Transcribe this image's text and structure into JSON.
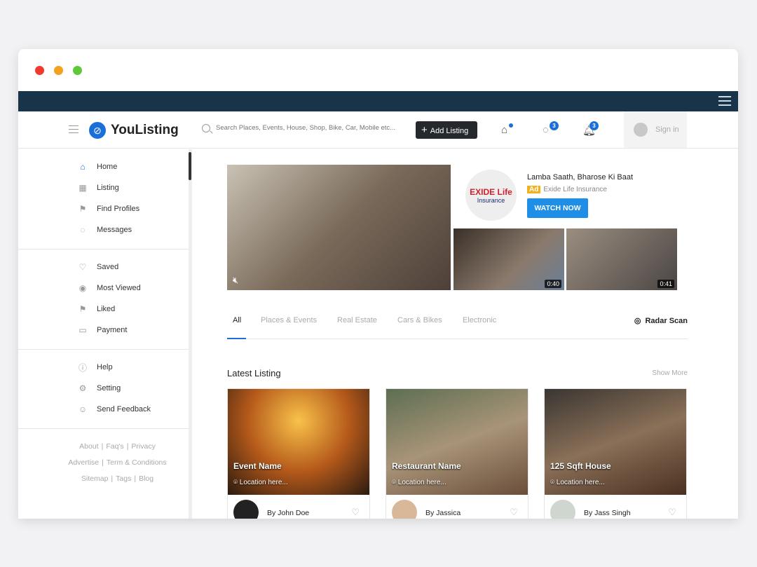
{
  "window": {
    "dots": [
      "#ee3b2e",
      "#f4a21e",
      "#5ec83a"
    ]
  },
  "header": {
    "logo": "YouListing",
    "search_placeholder": "Search Places, Events, House, Shop, Bike, Car, Mobile etc...",
    "add_listing": "Add Listing",
    "messages_count": "3",
    "notifications_count": "3",
    "sign_in": "Sign in"
  },
  "sidebar": {
    "groups": [
      [
        {
          "label": "Home",
          "icon": "⌂"
        },
        {
          "label": "Listing",
          "icon": "▦"
        },
        {
          "label": "Find Profiles",
          "icon": "⚑"
        },
        {
          "label": "Messages",
          "icon": "◌"
        }
      ],
      [
        {
          "label": "Saved",
          "icon": "♡"
        },
        {
          "label": "Most Viewed",
          "icon": "◉"
        },
        {
          "label": "Liked",
          "icon": "⚑"
        },
        {
          "label": "Payment",
          "icon": "▭"
        }
      ],
      [
        {
          "label": "Help",
          "icon": "ⓘ"
        },
        {
          "label": "Setting",
          "icon": "⚙"
        },
        {
          "label": "Send Feedback",
          "icon": "☺"
        }
      ]
    ],
    "footer": [
      "About",
      "Faq's",
      "Privacy",
      "Advertise",
      "Term & Conditions",
      "Sitemap",
      "Tags",
      "Blog"
    ]
  },
  "ad": {
    "title": "Lamba Saath, Bharose Ki Baat",
    "badge": "Ad",
    "advertiser": "Exide Life Insurance",
    "cta": "WATCH NOW",
    "logo_text": "EXIDE Life",
    "logo_sub": "Insurance",
    "durations": [
      "0:40",
      "0:41"
    ]
  },
  "tabs": {
    "items": [
      "All",
      "Places & Events",
      "Real Estate",
      "Cars & Bikes",
      "Electronic"
    ],
    "radar": "Radar Scan"
  },
  "latest": {
    "title": "Latest Listing",
    "show_more": "Show More",
    "cards": [
      {
        "name": "Event Name",
        "location": "Location here...",
        "by": "By John Doe"
      },
      {
        "name": "Restaurant Name",
        "location": "Location here...",
        "by": "By Jassica"
      },
      {
        "name": "125 Sqft House",
        "location": "Location here...",
        "by": "By Jass Singh"
      }
    ]
  }
}
